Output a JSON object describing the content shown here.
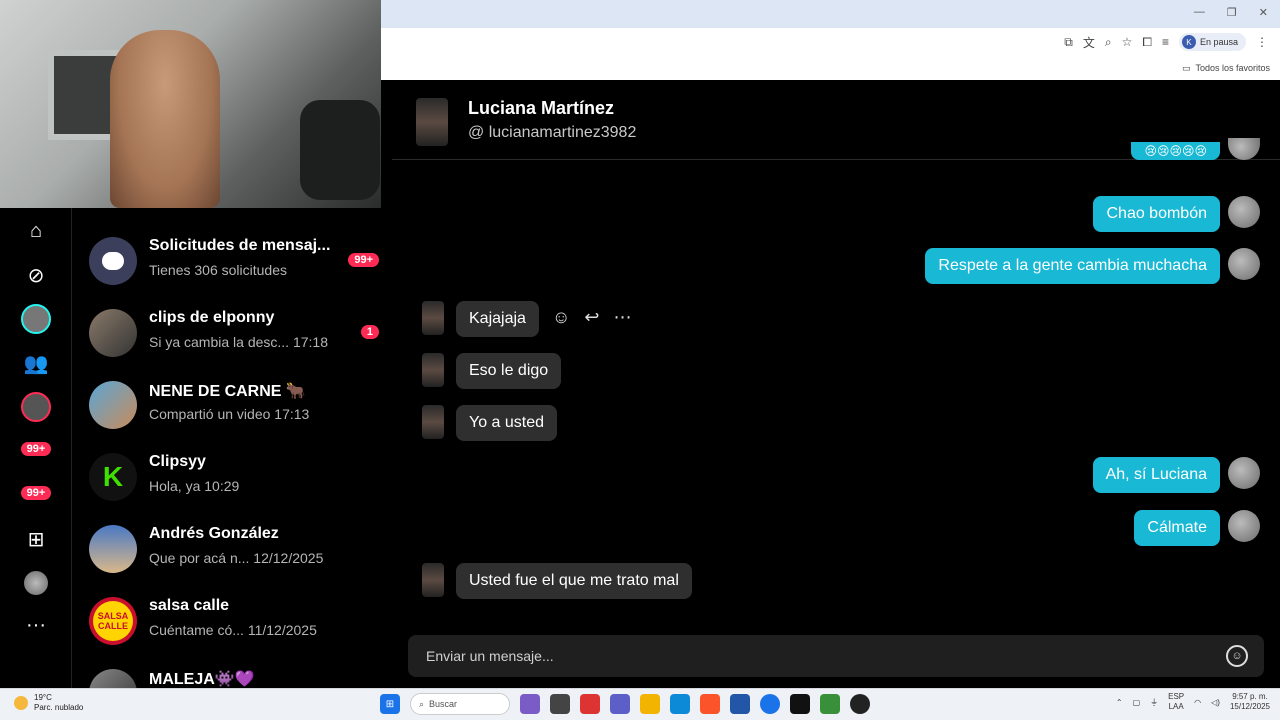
{
  "browser": {
    "profile_initial": "K",
    "profile_status": "En pausa",
    "bookmarks_label": "Todos los favoritos"
  },
  "nav": {
    "badge_activity": "99+",
    "badge_messages": "99+",
    "more_label": "···"
  },
  "conversations": [
    {
      "name": "Solicitudes de mensaj...",
      "preview": "Tienes 306 solicitudes",
      "badge": "99+"
    },
    {
      "name": "clips de elponny",
      "preview": "Si ya cambia la desc...",
      "time": "17:18",
      "badge": "1"
    },
    {
      "name": "NENE DE CARNE 🐂",
      "preview": "Compartió un video",
      "time": "17:13"
    },
    {
      "name": "Clipsyy",
      "preview": "Hola, ya",
      "time": "10:29"
    },
    {
      "name": "Andrés González",
      "preview": "Que por acá n...",
      "time": "12/12/2025"
    },
    {
      "name": "salsa calle",
      "preview": "Cuéntame có...",
      "time": "11/12/2025"
    },
    {
      "name": "MALEJA👾💜",
      "preview": ""
    }
  ],
  "avatar_text": {
    "clipsyy": "K",
    "salsa": "SALSA CALLE"
  },
  "chat": {
    "contact_name": "Luciana Martínez",
    "contact_handle": "@ lucianamartinez3982",
    "messages": [
      {
        "dir": "out",
        "text": "😢😢😢😢😢"
      },
      {
        "dir": "out",
        "text": "Chao bombón"
      },
      {
        "dir": "out",
        "text": "Respete a la gente cambia muchacha"
      },
      {
        "dir": "in",
        "text": "Kajajaja"
      },
      {
        "dir": "in",
        "text": "Eso le digo"
      },
      {
        "dir": "in",
        "text": "Yo a usted"
      },
      {
        "dir": "out",
        "text": "Ah, sí Luciana"
      },
      {
        "dir": "out",
        "text": "Cálmate"
      },
      {
        "dir": "in",
        "text": "Usted fue el que me trato mal"
      }
    ],
    "composer_placeholder": "Enviar un mensaje..."
  },
  "taskbar": {
    "temperature": "19°C",
    "weather": "Parc. nublado",
    "search_placeholder": "Buscar",
    "lang_top": "ESP",
    "lang_bottom": "LAA",
    "time": "9:57 p. m.",
    "date": "15/12/2025"
  },
  "colors": {
    "outgoing": "#19b8d4",
    "incoming": "#2f2f2f",
    "badge": "#fe2c55"
  }
}
